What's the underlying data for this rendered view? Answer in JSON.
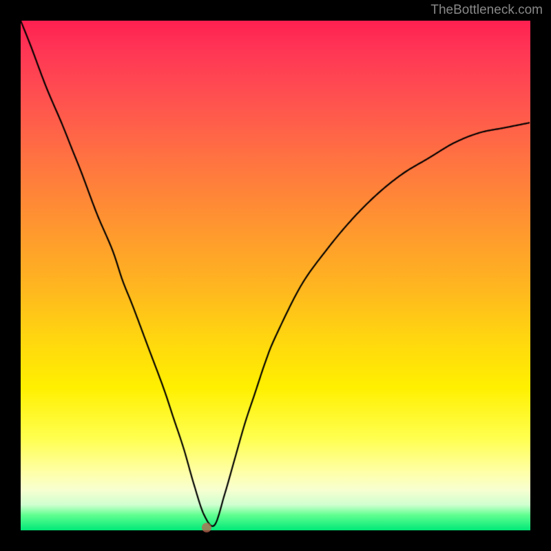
{
  "watermark": "TheBottleneck.com",
  "colors": {
    "background": "#000000",
    "gradient_top": "#ff2050",
    "gradient_bottom": "#00e878",
    "curve": "#000000",
    "marker": "rgba(190,100,80,0.75)"
  },
  "chart_data": {
    "type": "line",
    "title": "",
    "xlabel": "",
    "ylabel": "",
    "xlim": [
      0,
      1
    ],
    "ylim": [
      0,
      1
    ],
    "grid": false,
    "legend": false,
    "series": [
      {
        "name": "bottleneck-curve",
        "x": [
          0.0,
          0.02,
          0.05,
          0.08,
          0.1,
          0.12,
          0.15,
          0.18,
          0.2,
          0.22,
          0.25,
          0.28,
          0.3,
          0.32,
          0.34,
          0.36,
          0.38,
          0.4,
          0.42,
          0.44,
          0.46,
          0.48,
          0.5,
          0.55,
          0.6,
          0.65,
          0.7,
          0.75,
          0.8,
          0.85,
          0.9,
          0.95,
          1.0
        ],
        "y": [
          1.0,
          0.95,
          0.87,
          0.8,
          0.75,
          0.7,
          0.62,
          0.55,
          0.49,
          0.44,
          0.36,
          0.28,
          0.22,
          0.16,
          0.09,
          0.03,
          0.01,
          0.07,
          0.14,
          0.21,
          0.27,
          0.33,
          0.38,
          0.48,
          0.55,
          0.61,
          0.66,
          0.7,
          0.73,
          0.76,
          0.78,
          0.79,
          0.8
        ]
      }
    ],
    "marker": {
      "x": 0.365,
      "y": 0.005
    }
  }
}
